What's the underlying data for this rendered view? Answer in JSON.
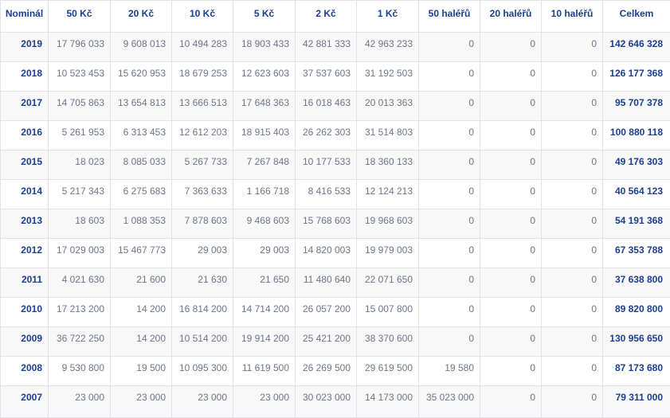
{
  "table": {
    "headers": [
      "Nominál",
      "50 Kč",
      "20 Kč",
      "10 Kč",
      "5 Kč",
      "2 Kč",
      "1 Kč",
      "50 haléřů",
      "20 haléřů",
      "10 haléřů",
      "Celkem"
    ],
    "rows": [
      [
        "2019",
        "17 796 033",
        "9 608 013",
        "10 494 283",
        "18 903 433",
        "42 881 333",
        "42 963 233",
        "0",
        "0",
        "0",
        "142 646 328"
      ],
      [
        "2018",
        "10 523 453",
        "15 620 953",
        "18 679 253",
        "12 623 603",
        "37 537 603",
        "31 192 503",
        "0",
        "0",
        "0",
        "126 177 368"
      ],
      [
        "2017",
        "14 705 863",
        "13 654 813",
        "13 666 513",
        "17 648 363",
        "16 018 463",
        "20 013 363",
        "0",
        "0",
        "0",
        "95 707 378"
      ],
      [
        "2016",
        "5 261 953",
        "6 313 453",
        "12 612 203",
        "18 915 403",
        "26 262 303",
        "31 514 803",
        "0",
        "0",
        "0",
        "100 880 118"
      ],
      [
        "2015",
        "18 023",
        "8 085 033",
        "5 267 733",
        "7 267 848",
        "10 177 533",
        "18 360 133",
        "0",
        "0",
        "0",
        "49 176 303"
      ],
      [
        "2014",
        "5 217 343",
        "6 275 683",
        "7 363 633",
        "1 166 718",
        "8 416 533",
        "12 124 213",
        "0",
        "0",
        "0",
        "40 564 123"
      ],
      [
        "2013",
        "18 603",
        "1 088 353",
        "7 878 603",
        "9 468 603",
        "15 768 603",
        "19 968 603",
        "0",
        "0",
        "0",
        "54 191 368"
      ],
      [
        "2012",
        "17 029 003",
        "15 467 773",
        "29 003",
        "29 003",
        "14 820 003",
        "19 979 003",
        "0",
        "0",
        "0",
        "67 353 788"
      ],
      [
        "2011",
        "4 021 630",
        "21 600",
        "21 630",
        "21 650",
        "11 480 640",
        "22 071 650",
        "0",
        "0",
        "0",
        "37 638 800"
      ],
      [
        "2010",
        "17 213 200",
        "14 200",
        "16 814 200",
        "14 714 200",
        "26 057 200",
        "15 007 800",
        "0",
        "0",
        "0",
        "89 820 800"
      ],
      [
        "2009",
        "36 722 250",
        "14 200",
        "10 514 200",
        "19 914 200",
        "25 421 200",
        "38 370 600",
        "0",
        "0",
        "0",
        "130 956 650"
      ],
      [
        "2008",
        "9 530 800",
        "19 500",
        "10 095 300",
        "11 619 500",
        "26 269 500",
        "29 619 500",
        "19 580",
        "0",
        "0",
        "87 173 680"
      ],
      [
        "2007",
        "23 000",
        "23 000",
        "23 000",
        "23 000",
        "30 023 000",
        "14 173 000",
        "35 023 000",
        "0",
        "0",
        "79 311 000"
      ]
    ]
  },
  "colors": {
    "accent": "#1b3f8f",
    "value_text": "#6e7588",
    "border": "#e1e1e6",
    "stripe": "#f8f8f9"
  }
}
